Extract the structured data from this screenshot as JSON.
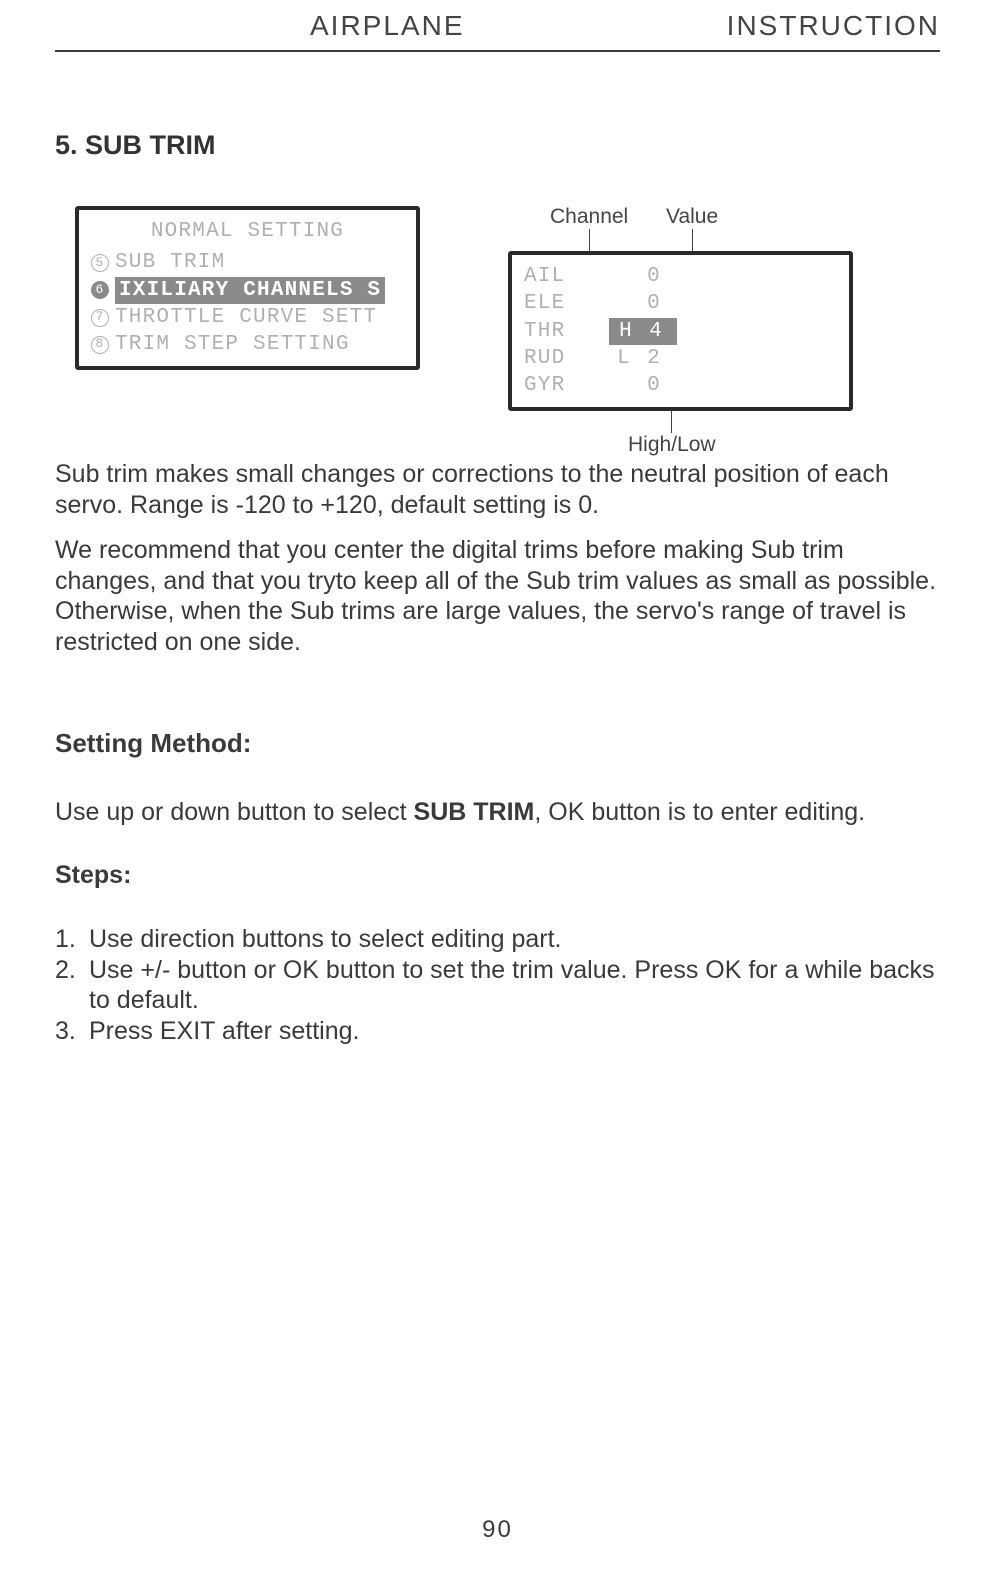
{
  "header": {
    "left": "AIRPLANE",
    "right": "INSTRUCTION"
  },
  "section_title": "5. SUB TRIM",
  "lcd_left": {
    "title": "NORMAL SETTING",
    "items": [
      {
        "num": "5",
        "label": "SUB TRIM",
        "selected": false
      },
      {
        "num": "6",
        "label": "IXILIARY CHANNELS S",
        "selected": true
      },
      {
        "num": "7",
        "label": "THROTTLE CURVE SETT",
        "selected": false
      },
      {
        "num": "8",
        "label": "TRIM STEP SETTING",
        "selected": false
      }
    ]
  },
  "lcd_right": {
    "rows": [
      {
        "ch": "AIL",
        "dir": "",
        "val": "0",
        "hl": false
      },
      {
        "ch": "ELE",
        "dir": "",
        "val": "0",
        "hl": false
      },
      {
        "ch": "THR",
        "dir": "H",
        "val": "4",
        "hl": true
      },
      {
        "ch": "RUD",
        "dir": "L",
        "val": "2",
        "hl": false
      },
      {
        "ch": "GYR",
        "dir": "",
        "val": "0",
        "hl": false
      }
    ]
  },
  "callouts": {
    "channel": "Channel",
    "value": "Value",
    "highlow": "High/Low"
  },
  "paragraph1": "Sub trim makes small changes or corrections to the neutral position of each servo. Range is -120 to +120, default setting is 0.",
  "paragraph2": "We recommend that you center the digital trims before making Sub trim changes, and that you tryto keep all of the Sub trim values as small as possible. Otherwise, when the Sub trims are large values, the servo's range of travel is restricted on one side.",
  "setting_method_head": "Setting Method:",
  "setting_method_text_pre": "Use up or down button to select ",
  "setting_method_bold": "SUB TRIM",
  "setting_method_text_post": ", OK button is to enter editing.",
  "steps_head": "Steps:",
  "steps": [
    {
      "n": "1.",
      "t": "Use direction buttons to select editing part."
    },
    {
      "n": "2.",
      "t": "Use +/- button or OK button to set the trim value. Press OK for a while backs to default."
    },
    {
      "n": "3.",
      "t": "Press EXIT after setting."
    }
  ],
  "page_number": "90"
}
